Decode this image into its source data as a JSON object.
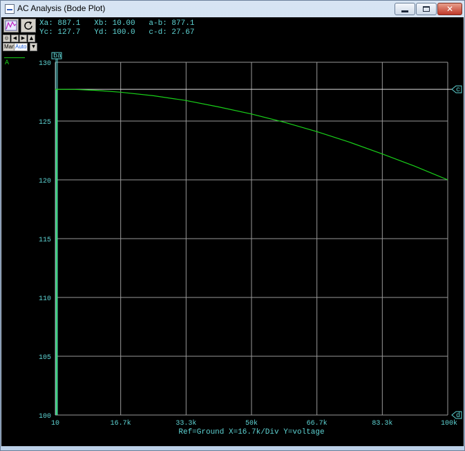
{
  "window": {
    "title": "AC Analysis (Bode Plot)"
  },
  "toolbar": {
    "small_buttons": [
      "◎",
      "◀",
      "▶",
      "▲"
    ],
    "mode_man": "Man",
    "mode_auto": "Auto",
    "mode_dropdown": "▼"
  },
  "readout": {
    "line1": "Xa: 887.1   Xb: 10.00   a-b: 877.1",
    "line2": "Yc: 127.7   Yd: 100.0   c-d: 27.67"
  },
  "legend": {
    "series": "A"
  },
  "cursor_labels": {
    "a": "a",
    "b": "b",
    "c": "c",
    "d": "d"
  },
  "footer": "Ref=Ground  X=16.7k/Div Y=voltage",
  "colors": {
    "trace": "#19d119",
    "text": "#5ed4d4",
    "grid": "#9a9a9a",
    "background": "#000000"
  },
  "chart_data": {
    "type": "line",
    "x_tick_labels": [
      "10",
      "16.7k",
      "33.3k",
      "50k",
      "66.7k",
      "83.3k",
      "100k"
    ],
    "y_tick_labels": [
      "130",
      "125",
      "120",
      "115",
      "110",
      "105",
      "100"
    ],
    "xlim": [
      10,
      100000
    ],
    "ylim": [
      100,
      130
    ],
    "grid": true,
    "series": [
      {
        "x": [
          10,
          5000,
          10000,
          16670,
          25000,
          33330,
          41670,
          50000,
          58330,
          66670,
          75000,
          83330,
          91670,
          100000
        ],
        "values": [
          127.7,
          127.69,
          127.62,
          127.45,
          127.15,
          126.75,
          126.2,
          125.6,
          124.9,
          124.1,
          123.2,
          122.2,
          121.15,
          120.0
        ]
      }
    ]
  }
}
